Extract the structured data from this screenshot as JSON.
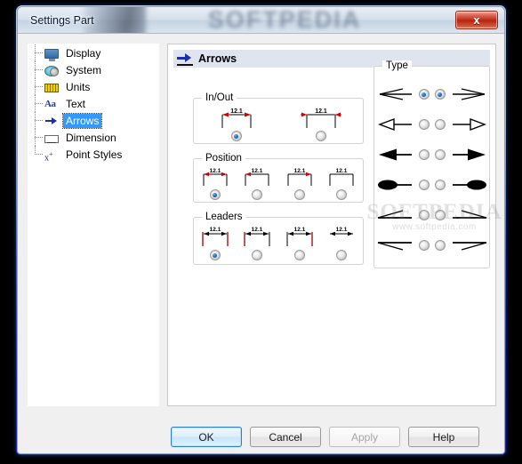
{
  "window": {
    "title": "Settings Part",
    "close_label": "x",
    "watermark": "SOFTPEDIA"
  },
  "sidebar": {
    "items": [
      {
        "label": "Display",
        "icon": "monitor-icon",
        "selected": false
      },
      {
        "label": "System",
        "icon": "disc-icon",
        "selected": false
      },
      {
        "label": "Units",
        "icon": "ruler-icon",
        "selected": false
      },
      {
        "label": "Text",
        "icon": "text-aa-icon",
        "selected": false
      },
      {
        "label": "Arrows",
        "icon": "arrow-icon",
        "selected": true
      },
      {
        "label": "Dimension",
        "icon": "dimension-icon",
        "selected": false
      },
      {
        "label": "Point Styles",
        "icon": "point-styles-icon",
        "selected": false
      }
    ]
  },
  "panel": {
    "title": "Arrows",
    "icon": "arrow-icon",
    "dimension_value": "12.1",
    "groups": {
      "inout": {
        "title": "In/Out",
        "options": [
          {
            "name": "arrows-inside",
            "checked": true
          },
          {
            "name": "arrows-outside",
            "checked": false
          }
        ]
      },
      "position": {
        "title": "Position",
        "options": [
          {
            "name": "position-both",
            "checked": true
          },
          {
            "name": "position-left",
            "checked": false
          },
          {
            "name": "position-right",
            "checked": false
          },
          {
            "name": "position-none",
            "checked": false
          }
        ]
      },
      "leaders": {
        "title": "Leaders",
        "options": [
          {
            "name": "leaders-both",
            "checked": true
          },
          {
            "name": "leaders-left",
            "checked": false
          },
          {
            "name": "leaders-right",
            "checked": false
          },
          {
            "name": "leaders-none",
            "checked": false
          }
        ]
      },
      "type": {
        "title": "Type",
        "rows": [
          {
            "style": "open-arrow",
            "left_checked": true,
            "right_checked": true
          },
          {
            "style": "hollow-triangle",
            "left_checked": false,
            "right_checked": false
          },
          {
            "style": "filled-triangle",
            "left_checked": false,
            "right_checked": false
          },
          {
            "style": "filled-ellipse",
            "left_checked": false,
            "right_checked": false
          },
          {
            "style": "half-arrow-up",
            "left_checked": false,
            "right_checked": false
          },
          {
            "style": "half-arrow-down",
            "left_checked": false,
            "right_checked": false
          }
        ]
      }
    }
  },
  "overlay_watermark": {
    "big": "SOFTPEDIA",
    "small": "www.softpedia.com"
  },
  "buttons": [
    {
      "label": "OK",
      "state": "default"
    },
    {
      "label": "Cancel",
      "state": "normal"
    },
    {
      "label": "Apply",
      "state": "disabled"
    },
    {
      "label": "Help",
      "state": "normal"
    }
  ]
}
